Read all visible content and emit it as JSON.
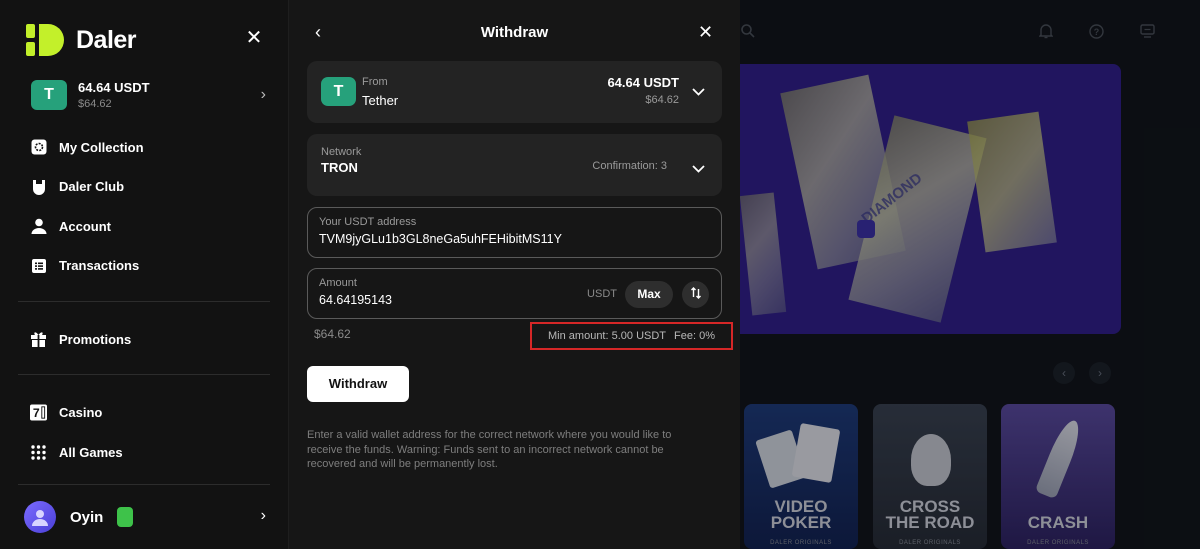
{
  "brand": {
    "name": "Daler",
    "accent": "#c3f02a"
  },
  "sidebar": {
    "balance": {
      "amount": "64.64 USDT",
      "fiat": "$64.62",
      "token_icon": "T"
    },
    "nav_primary": [
      {
        "label": "My Collection",
        "icon": "collection-icon"
      },
      {
        "label": "Daler Club",
        "icon": "club-icon"
      },
      {
        "label": "Account",
        "icon": "user-icon"
      },
      {
        "label": "Transactions",
        "icon": "list-icon"
      }
    ],
    "nav_promo": {
      "label": "Promotions",
      "icon": "gift-icon"
    },
    "nav_games": [
      {
        "label": "Casino",
        "icon": "seven-icon"
      },
      {
        "label": "All Games",
        "icon": "grid-icon"
      }
    ],
    "user": {
      "name": "Oyin"
    }
  },
  "withdraw": {
    "title": "Withdraw",
    "from": {
      "label": "From",
      "currency": "Tether",
      "token_icon": "T",
      "amount": "64.64 USDT",
      "fiat": "$64.62"
    },
    "network": {
      "label": "Network",
      "value": "TRON",
      "confirmation": "Confirmation: 3"
    },
    "address": {
      "label": "Your USDT address",
      "value": "TVM9jyGLu1b3GL8neGa5uhFEHibitMS11Y"
    },
    "amount": {
      "label": "Amount",
      "value": "64.64195143",
      "unit": "USDT",
      "max_label": "Max"
    },
    "usd_equivalent": "$64.62",
    "min_amount": "Min amount: 5.00 USDT",
    "fee": "Fee: 0%",
    "button": "Withdraw",
    "warning": "Enter a valid wallet address for the correct network where you would like to receive the funds. Warning: Funds sent to an incorrect network cannot be recovered and will be permanently lost."
  },
  "games": [
    {
      "title_1": "VIDEO",
      "title_2": "POKER",
      "sub": "DALER ORIGINALS"
    },
    {
      "title_1": "CROSS",
      "title_2": "THE ROAD",
      "sub": "DALER ORIGINALS"
    },
    {
      "title_1": "",
      "title_2": "CRASH",
      "sub": "DALER ORIGINALS"
    }
  ],
  "banner": {
    "pack_text": "DIAMOND"
  }
}
